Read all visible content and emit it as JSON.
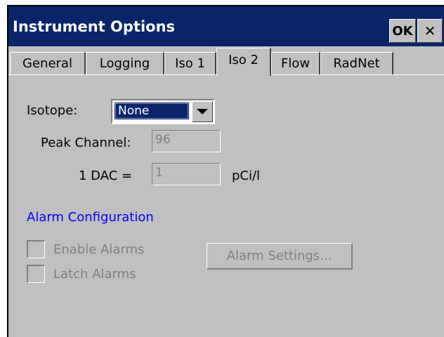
{
  "window": {
    "title": "Instrument Options",
    "ok_label": "OK",
    "close_label": "✕"
  },
  "tabs": [
    {
      "label": "General",
      "active": false
    },
    {
      "label": "Logging",
      "active": false
    },
    {
      "label": "Iso 1",
      "active": false
    },
    {
      "label": "Iso 2",
      "active": true
    },
    {
      "label": "Flow",
      "active": false
    },
    {
      "label": "RadNet",
      "active": false
    }
  ],
  "form": {
    "isotope_label": "Isotope:",
    "isotope_value": "None",
    "peak_channel_label": "Peak Channel:",
    "peak_channel_value": "96",
    "dac_label": "1 DAC =",
    "dac_value": "1",
    "dac_unit": "pCi/l"
  },
  "alarm": {
    "section_title": "Alarm Configuration",
    "enable_label": "Enable Alarms",
    "latch_label": "Latch Alarms",
    "settings_label": "Alarm Settings..."
  },
  "colors": {
    "titlebar": "#0a246a",
    "dialog_bg": "#c0c0c0",
    "section_title": "#0000ff",
    "disabled_text": "#808080"
  }
}
